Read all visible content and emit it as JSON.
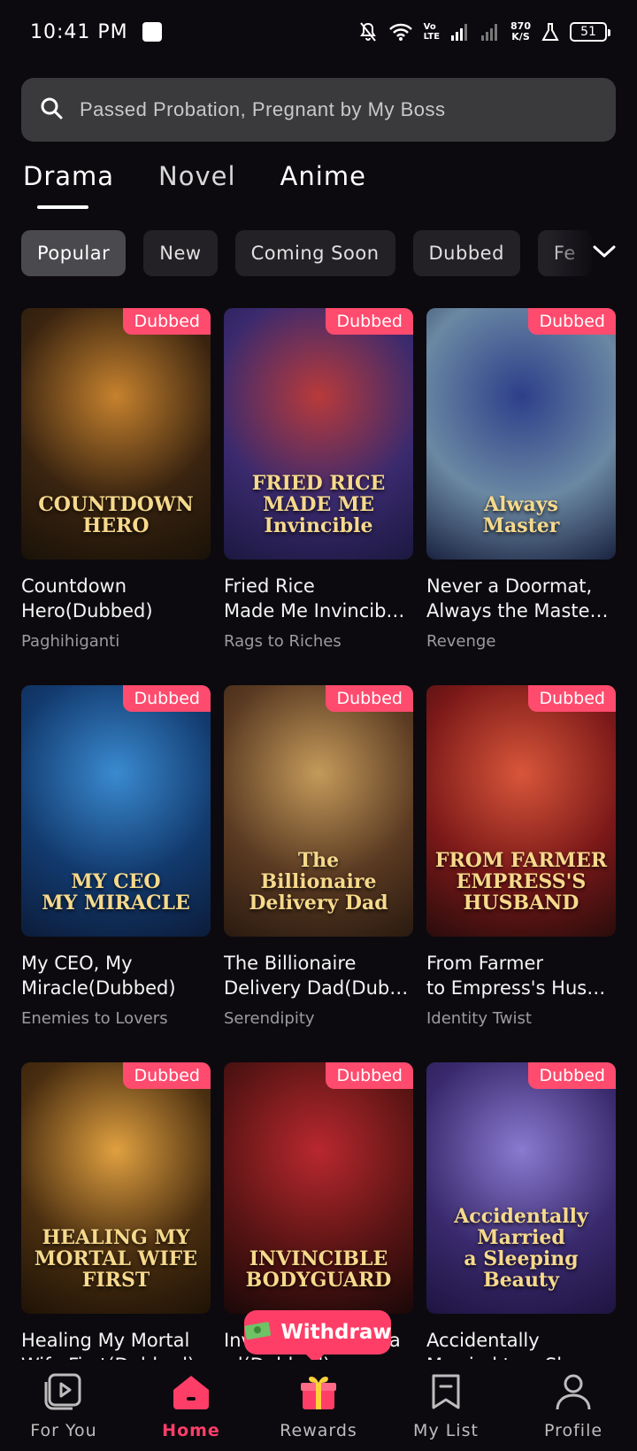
{
  "status": {
    "time": "10:41 PM",
    "volte_top": "Vo",
    "volte_bottom": "LTE",
    "speed_value": "870",
    "speed_unit": "K/S",
    "battery": "51"
  },
  "search": {
    "placeholder": "Passed Probation, Pregnant by My Boss"
  },
  "tabs": [
    "Drama",
    "Novel",
    "Anime"
  ],
  "chips": [
    "Popular",
    "New",
    "Coming Soon",
    "Dubbed",
    "Fe"
  ],
  "badge_label": "Dubbed",
  "cards": [
    {
      "title1": "Countdown",
      "title2": "Hero(Dubbed)",
      "tag": "Paghihiganti",
      "poster_text": "COUNTDOWN\nHERO",
      "colors": [
        "#3a2410",
        "#c6822e",
        "#1a1208"
      ]
    },
    {
      "title1": "Fried Rice",
      "title2": "Made Me Invincib…",
      "tag": "Rags to Riches",
      "poster_text": "FRIED RICE\nMADE ME Invincible",
      "colors": [
        "#3a2a6e",
        "#b83a3a",
        "#1b1840"
      ]
    },
    {
      "title1": "Never a Doormat,",
      "title2": "Always the Maste…",
      "tag": "Revenge",
      "poster_text": "Always\nMaster",
      "colors": [
        "#6b88a3",
        "#2d3f8a",
        "#1a2340"
      ]
    },
    {
      "title1": "My CEO, My",
      "title2": "Miracle(Dubbed)",
      "tag": "Enemies to Lovers",
      "poster_text": "MY CEO\nMY MIRACLE",
      "colors": [
        "#123a6e",
        "#3a8ad0",
        "#0c1c3a"
      ]
    },
    {
      "title1": "The Billionaire",
      "title2": "Delivery Dad(Dub…",
      "tag": "Serendipity",
      "poster_text": "The\nBillionaire\nDelivery Dad",
      "colors": [
        "#5a3a22",
        "#c49a5a",
        "#2a1a10"
      ]
    },
    {
      "title1": "From Farmer",
      "title2": "to Empress's Hus…",
      "tag": "Identity Twist",
      "poster_text": "FROM FARMER\nEMPRESS'S HUSBAND",
      "colors": [
        "#7a1818",
        "#d8563a",
        "#2a0c0c"
      ]
    },
    {
      "title1": "Healing My Mortal",
      "title2": "Wife First(Dubbed)",
      "tag": "",
      "poster_text": "HEALING MY\nMORTAL WIFE\nFIRST",
      "colors": [
        "#4a2e10",
        "#e0a040",
        "#1e1206"
      ]
    },
    {
      "title1": "Invincible Bodygua",
      "title2": "rd(Dubbed)",
      "tag": "",
      "poster_text": "INVINCIBLE\nBODYGUARD",
      "colors": [
        "#5a1414",
        "#b8282e",
        "#1a0808"
      ]
    },
    {
      "title1": "Accidentally",
      "title2": "Married to a Sleepin…",
      "tag": "",
      "poster_text": "Accidentally\nMarried\na Sleeping Beauty",
      "colors": [
        "#3a2a6e",
        "#8a7ad0",
        "#1e1440"
      ]
    }
  ],
  "withdraw_label": "Withdraw",
  "nav": [
    {
      "label": "For You",
      "icon": "play-card-icon"
    },
    {
      "label": "Home",
      "icon": "home-icon"
    },
    {
      "label": "Rewards",
      "icon": "gift-icon"
    },
    {
      "label": "My List",
      "icon": "bookmark-icon"
    },
    {
      "label": "Profile",
      "icon": "profile-icon"
    }
  ],
  "accent": "#ff3e68"
}
